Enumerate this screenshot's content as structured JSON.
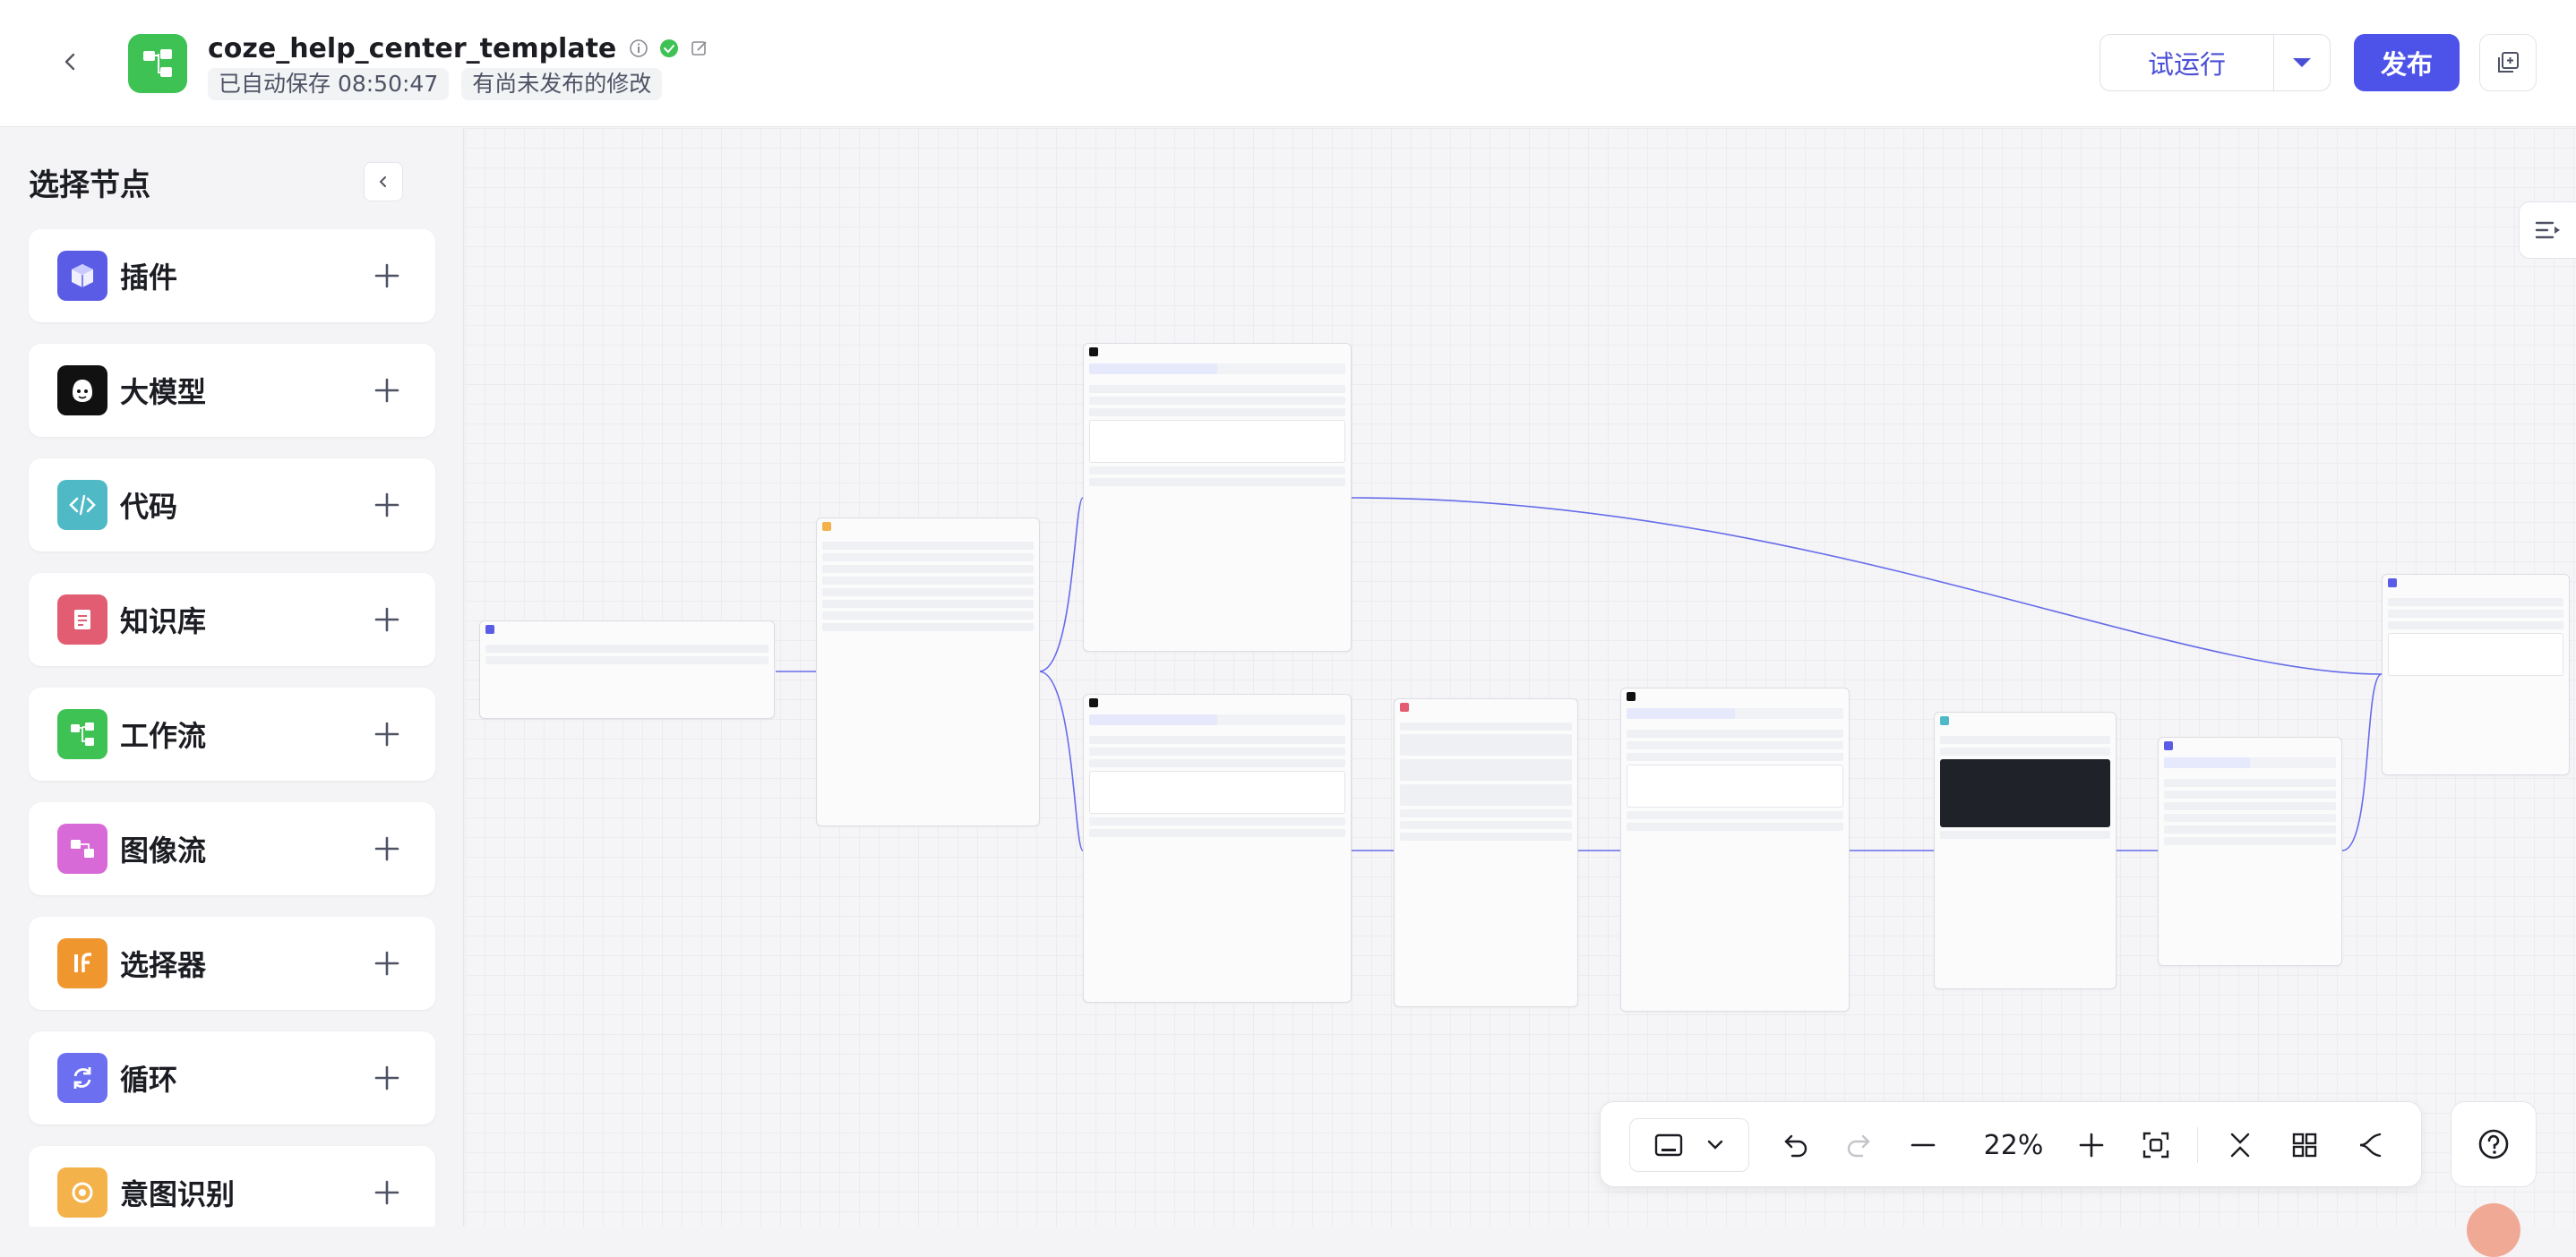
{
  "header": {
    "title": "coze_help_center_template",
    "autosave": "已自动保存 08:50:47",
    "unpublished": "有尚未发布的修改",
    "run_label": "试运行",
    "publish_label": "发布"
  },
  "sidebar": {
    "title": "选择节点",
    "items": [
      {
        "label": "插件",
        "icon": "plugin-icon",
        "color": "#5b5ce6"
      },
      {
        "label": "大模型",
        "icon": "llm-icon",
        "color": "#111111"
      },
      {
        "label": "代码",
        "icon": "code-icon",
        "color": "#4fbac6"
      },
      {
        "label": "知识库",
        "icon": "knowledge-icon",
        "color": "#e25d72"
      },
      {
        "label": "工作流",
        "icon": "workflow-icon",
        "color": "#3ec254"
      },
      {
        "label": "图像流",
        "icon": "imageflow-icon",
        "color": "#d86ad8"
      },
      {
        "label": "选择器",
        "icon": "selector-icon",
        "color": "#f0962f"
      },
      {
        "label": "循环",
        "icon": "loop-icon",
        "color": "#6b6ff0"
      },
      {
        "label": "意图识别",
        "icon": "intent-icon",
        "color": "#f4b24a"
      }
    ]
  },
  "toolbar": {
    "zoom": "22%"
  },
  "colors": {
    "accent": "#4d53e8",
    "success": "#3ec254"
  }
}
